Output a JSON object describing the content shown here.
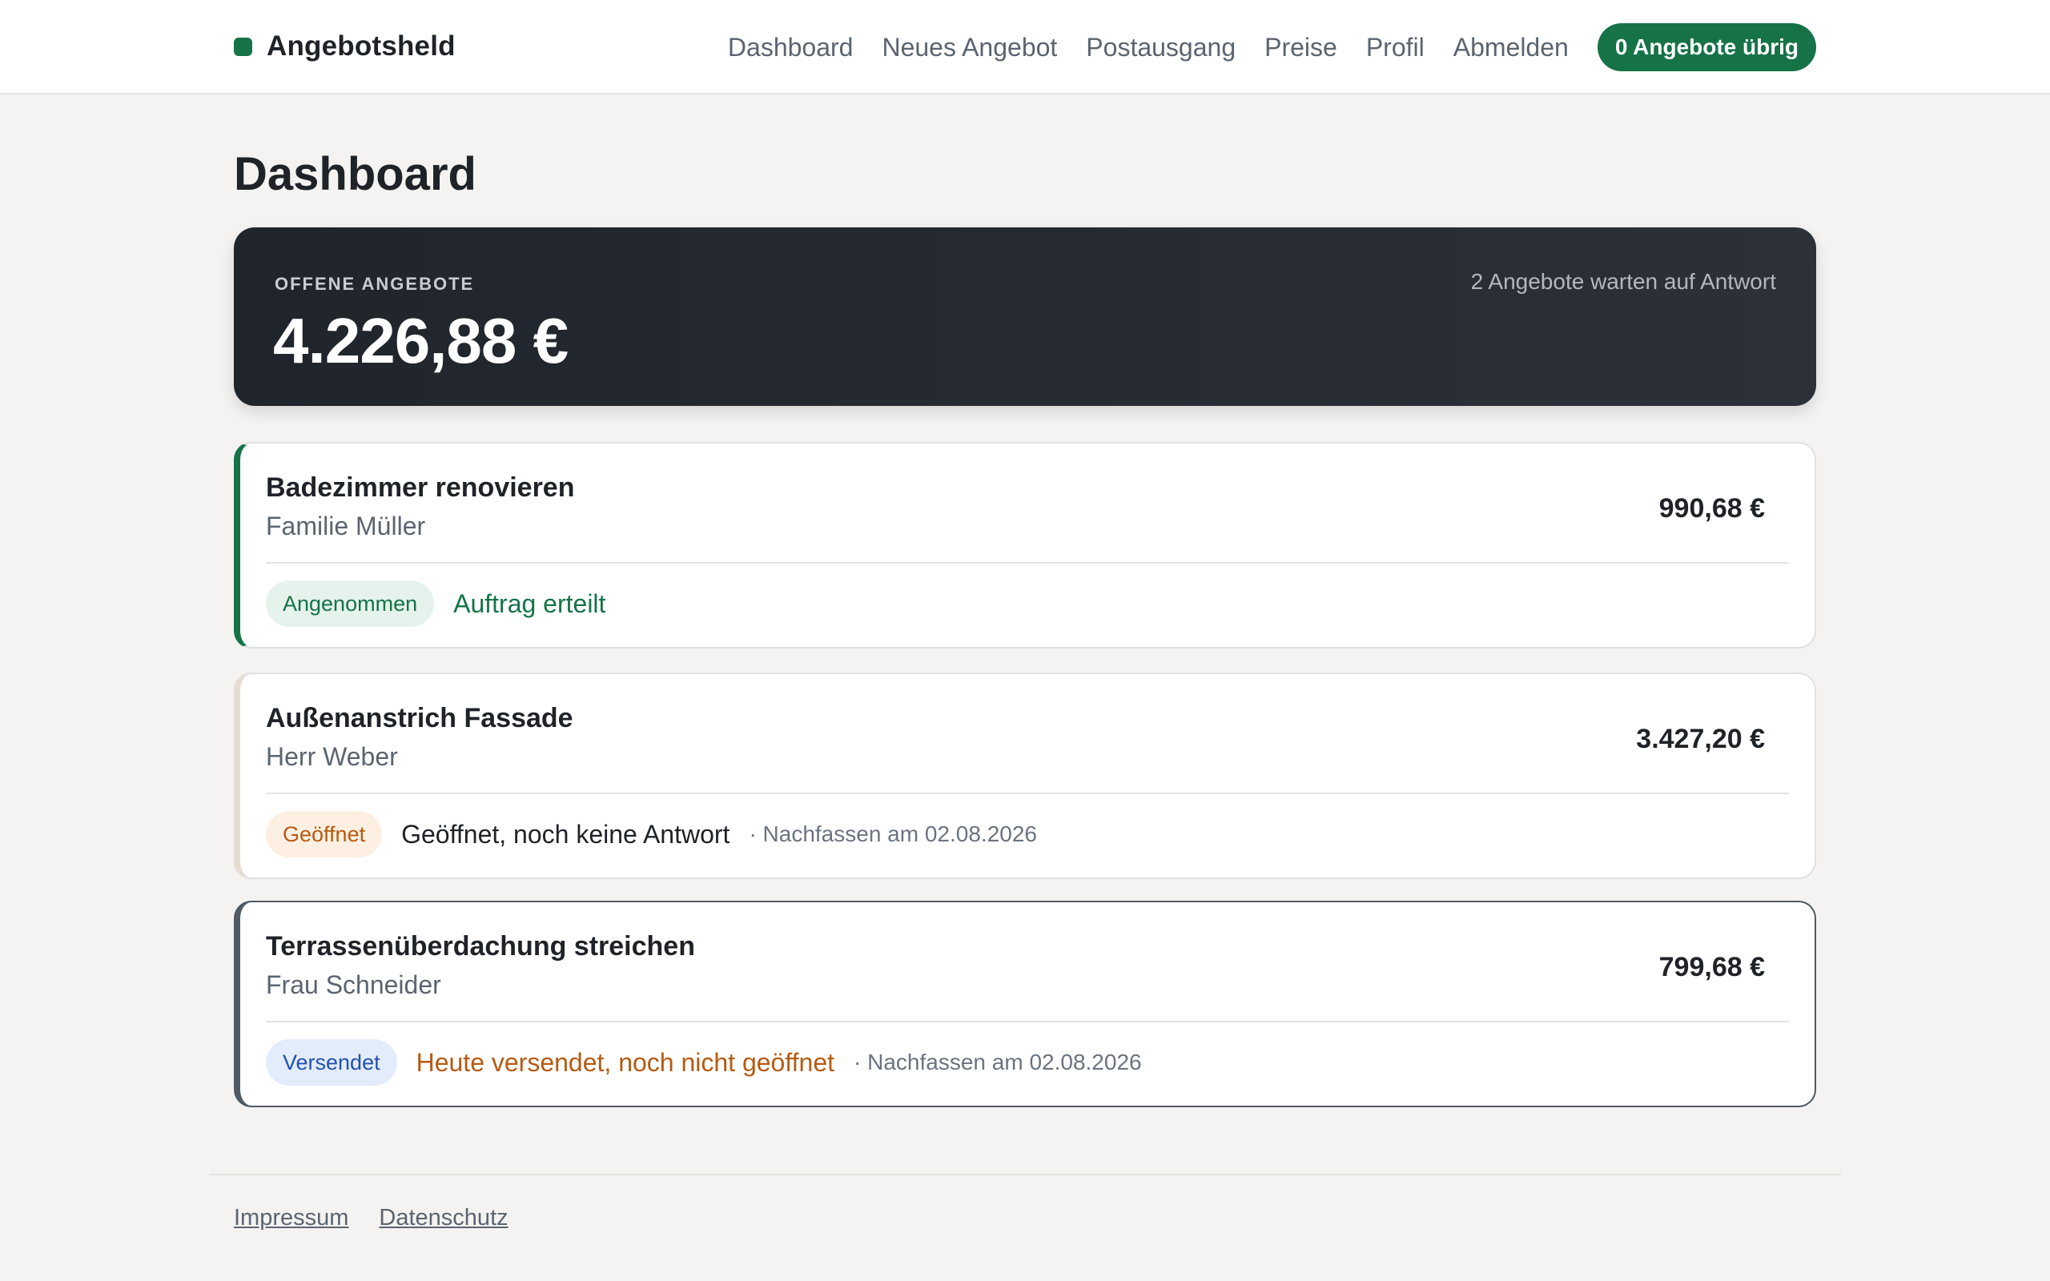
{
  "header": {
    "brand": "Angebotsheld",
    "brand_color": "#157347",
    "nav": [
      "Dashboard",
      "Neues Angebot",
      "Postausgang",
      "Preise",
      "Profil",
      "Abmelden"
    ],
    "quota_badge": "0 Angebote übrig"
  },
  "page": {
    "title": "Dashboard"
  },
  "summary": {
    "label": "OFFENE ANGEBOTE",
    "amount": "4.226,88 €",
    "note": "2 Angebote warten auf Antwort"
  },
  "offers": [
    {
      "title": "Badezimmer renovieren",
      "client": "Familie Müller",
      "amount": "990,68 €",
      "badge": "Angenommen",
      "status": "Auftrag erteilt",
      "followup": ""
    },
    {
      "title": "Außenanstrich Fassade",
      "client": "Herr Weber",
      "amount": "3.427,20 €",
      "badge": "Geöffnet",
      "status": "Geöffnet, noch keine Antwort",
      "followup": "· Nachfassen am 02.08.2026"
    },
    {
      "title": "Terrassenüberdachung streichen",
      "client": "Frau Schneider",
      "amount": "799,68 €",
      "badge": "Versendet",
      "status": "Heute versendet, noch nicht geöffnet",
      "followup": "· Nachfassen am 02.08.2026"
    }
  ],
  "footer": {
    "links": [
      "Impressum",
      "Datenschutz"
    ]
  }
}
